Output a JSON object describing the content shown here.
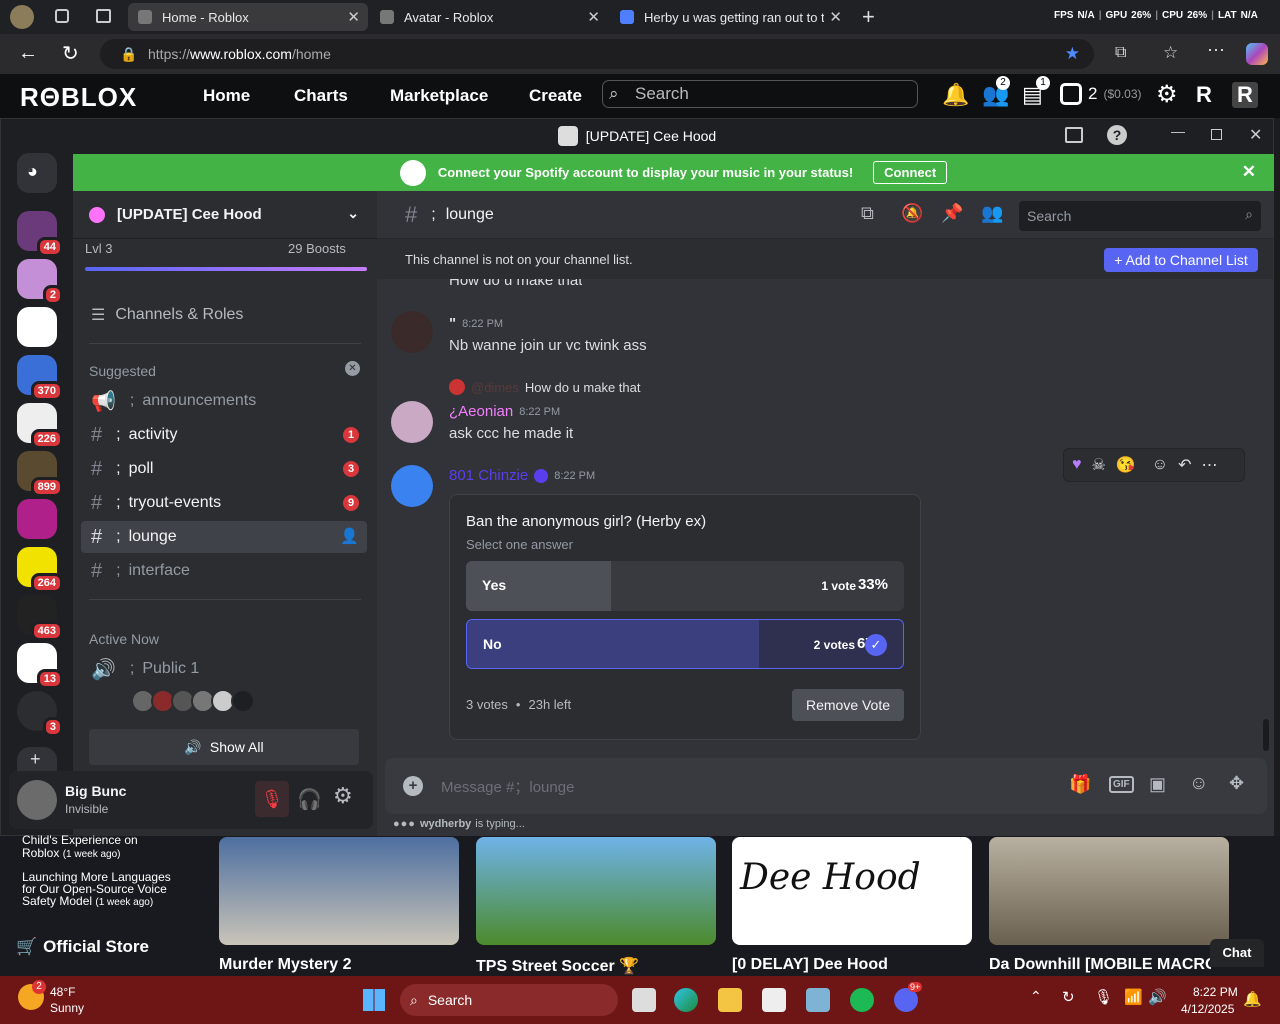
{
  "browser": {
    "tabs": [
      {
        "label": "Home - Roblox"
      },
      {
        "label": "Avatar - Roblox"
      },
      {
        "label": "Herby u was getting ran out to th"
      }
    ],
    "stats": {
      "fps": "FPS",
      "fps_val": "N/A",
      "gpu": "GPU",
      "gpu_val": "26%",
      "cpu": "CPU",
      "cpu_val": "26%",
      "lat": "LAT",
      "lat_val": "N/A"
    },
    "url_prefix": "https://",
    "url_domain": "www.roblox.com",
    "url_path": "/home"
  },
  "roblox": {
    "logo": "RΘBLOX",
    "nav": [
      "Home",
      "Charts",
      "Marketplace",
      "Create"
    ],
    "search_placeholder": "Search",
    "friends_badge": "2",
    "messages_badge": "1",
    "robux": "2",
    "robux_usd": "($0.03)"
  },
  "discord": {
    "window_title": "[UPDATE] Cee Hood",
    "spotify": {
      "text": "Connect your Spotify account to display your music in your status!",
      "button": "Connect"
    },
    "guild_badges": [
      "44",
      "2",
      "370",
      "226",
      "899",
      "264",
      "463",
      "13",
      "3"
    ],
    "server": {
      "name": "[UPDATE] Cee Hood",
      "level": "Lvl 3",
      "boosts": "29 Boosts",
      "channels_roles": "Channels & Roles",
      "suggested": "Suggested"
    },
    "channels": [
      {
        "name": "announcements",
        "badge": ""
      },
      {
        "name": "activity",
        "badge": "1"
      },
      {
        "name": "poll",
        "badge": "3"
      },
      {
        "name": "tryout-events",
        "badge": "9"
      },
      {
        "name": "lounge",
        "badge": ""
      },
      {
        "name": "interface",
        "badge": ""
      }
    ],
    "channel_prefix": ";",
    "active_now": "Active Now",
    "voice_channel": "Public 1",
    "show_all": "Show All",
    "user": {
      "name": "Big Bunc",
      "status": "Invisible"
    },
    "chat": {
      "channel": "lounge",
      "search_placeholder": "Search",
      "notice": "This channel is not on your channel list.",
      "add_button": "Add to Channel List",
      "cut_msg": "How do u make that",
      "msg1": {
        "author": "\"",
        "time": "8:22 PM",
        "text": "Nb wanne join ur vc twink ass"
      },
      "reply": {
        "to": "@dimes",
        "text": "How do u make that"
      },
      "msg2": {
        "author": "¿Aeonian",
        "time": "8:22 PM",
        "text": "ask ccc he made it"
      },
      "msg3": {
        "author": "801 Chinzie",
        "time": "8:22 PM"
      },
      "poll": {
        "question": "Ban the anonymous girl? (Herby ex)",
        "hint": "Select one answer",
        "options": [
          {
            "label": "Yes",
            "votes": "1 vote",
            "pct": "33%",
            "share": 0.33
          },
          {
            "label": "No",
            "votes": "2 votes",
            "pct": "67%",
            "share": 0.67
          }
        ],
        "footer_votes": "3 votes",
        "footer_sep": "•",
        "footer_left": "23h left",
        "remove": "Remove Vote"
      },
      "composer_placeholder": "Message #；lounge",
      "typing_user": "wydherby",
      "typing_text": "is typing..."
    }
  },
  "roblox_bottom": {
    "news1": "Child's Experience on",
    "news1b": "Roblox",
    "news1_age": "(1 week ago)",
    "news2": "Launching More Languages for Our Open-Source Voice Safety Model",
    "news2_age": "(1 week ago)",
    "store": "Official Store",
    "games": [
      "Murder Mystery 2",
      "TPS Street Soccer 🏆",
      "[0 DELAY] Dee Hood",
      "Da Downhill [MOBILE MACRO"
    ],
    "chat": "Chat"
  },
  "taskbar": {
    "weather_temp": "48°F",
    "weather_desc": "Sunny",
    "weather_badge": "2",
    "search": "Search",
    "time": "8:22 PM",
    "date": "4/12/2025",
    "discord_badge": "9+"
  }
}
